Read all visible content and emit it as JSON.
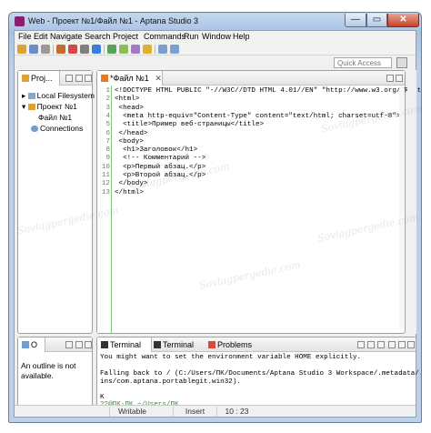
{
  "window": {
    "title": "Web - Проект №1/Файл №1 - Aptana Studio 3",
    "controls": {
      "minimize": "—",
      "maximize": "▭",
      "close": "✕"
    }
  },
  "menu": [
    "File",
    "Edit",
    "Navigate",
    "Search",
    "Project",
    "Commands",
    "Run",
    "Window",
    "Help"
  ],
  "quick_access": {
    "placeholder": "Quick Access"
  },
  "explorer": {
    "tab_label": "Proj...",
    "tree": [
      {
        "label": "Local Filesystem",
        "expander": "▸"
      },
      {
        "label": "Проект №1",
        "expander": "▾"
      },
      {
        "label": "Файл №1"
      },
      {
        "label": "Connections"
      }
    ]
  },
  "editor": {
    "tab_label": "*Файл №1",
    "close_glyph": "✕",
    "lines": [
      "<!DOCTYPE HTML PUBLIC \"-//W3C//DTD HTML 4.01//EN\" \"http://www.w3.org/TR/html4",
      "<html>",
      " <head>",
      "  <meta http-equiv=\"Content-Type\" content=\"text/html; charset=utf-8\">",
      "  <title>Пример веб-страницы</title>",
      " </head>",
      " <body>",
      "  <h1>Заголовок</h1>",
      "  <!-- Комментарий -->",
      "  <p>Первый абзац.</p>",
      "  <p>Второй абзац.</p>",
      " </body>",
      "</html>"
    ]
  },
  "outline": {
    "tab_label": "O",
    "message": "An outline is not available."
  },
  "console": {
    "tabs": [
      "Terminal",
      "Terminal",
      "Problems"
    ],
    "lines": [
      "You might want to set the environment variable HOME explicitly.",
      "",
      "Falling back to / (C:/Users/ПК/Documents/Aptana Studio 3 Workspace/.metadata/.plug",
      "ins/com.aptana.portablegit.win32).",
      "",
      "K",
      "??@ПК-ПК ~/Users/ПК",
      "$"
    ]
  },
  "status": {
    "mode": "Writable",
    "insert": "Insert",
    "position": "10 : 23"
  },
  "watermark": "Sovlagpergedie.com",
  "colors": {
    "accent_green": "#6fc36f",
    "code_tag": "#000000"
  }
}
